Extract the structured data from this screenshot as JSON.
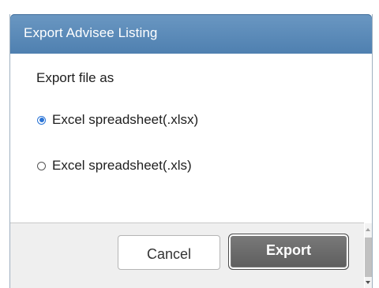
{
  "dialog": {
    "title": "Export Advisee Listing",
    "label": "Export file as",
    "options": [
      {
        "label": "Excel spreadsheet(.xlsx)",
        "selected": true
      },
      {
        "label": "Excel spreadsheet(.xls)",
        "selected": false
      }
    ],
    "buttons": {
      "cancel": "Cancel",
      "export": "Export"
    }
  },
  "colors": {
    "titlebar": "#5a8bbb",
    "radio_accent": "#2a74d6",
    "export_button": "#6a6a6a"
  }
}
